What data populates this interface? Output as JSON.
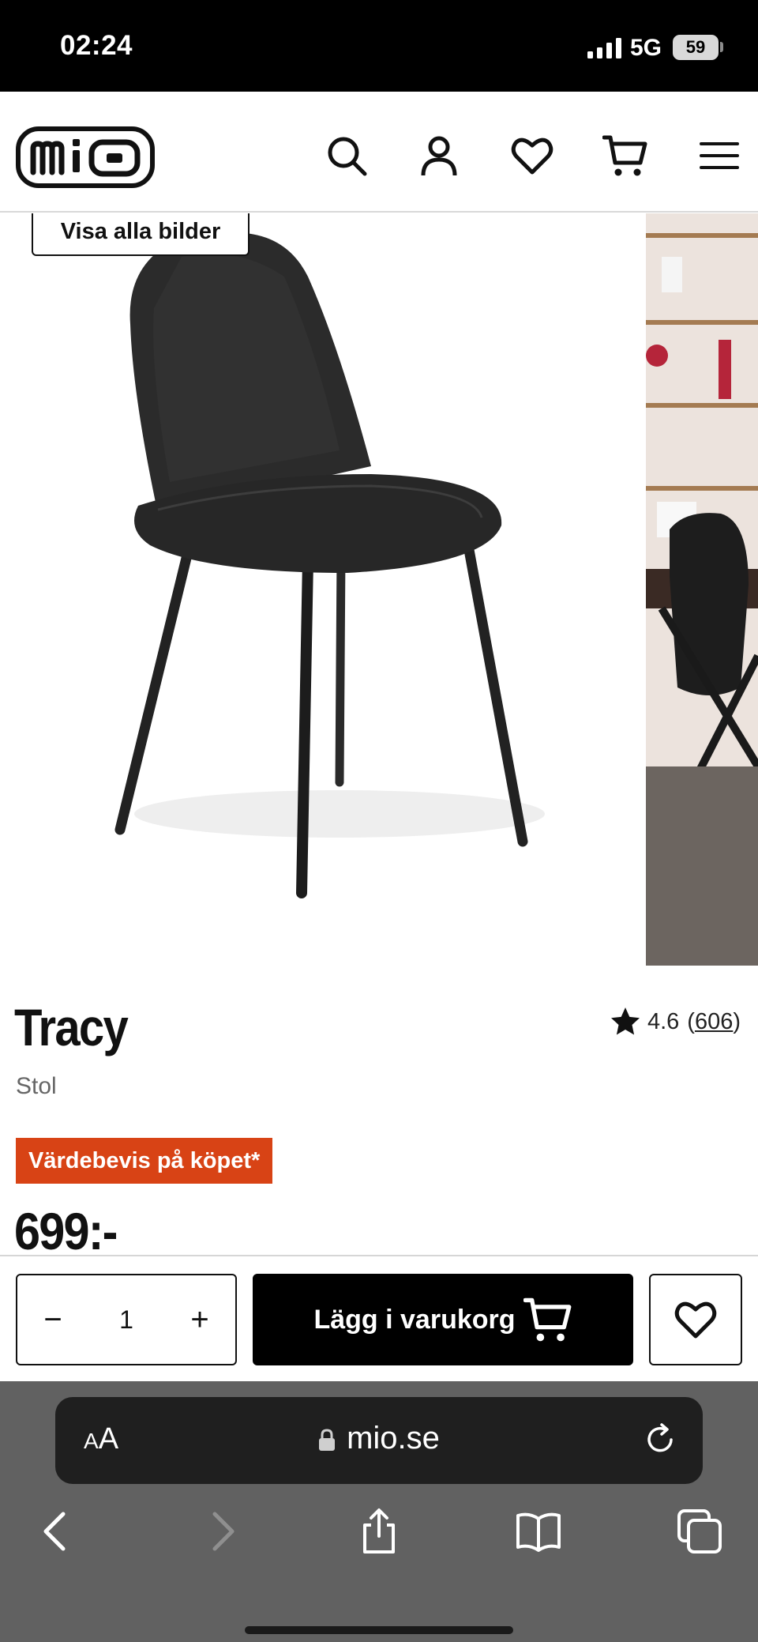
{
  "status_bar": {
    "time": "02:24",
    "network": "5G",
    "battery": "59"
  },
  "header": {
    "logo_text": "mio",
    "icons": [
      "search-icon",
      "account-icon",
      "heart-icon",
      "cart-icon",
      "menu-icon"
    ]
  },
  "gallery": {
    "show_all_label": "Visa alla bilder"
  },
  "product": {
    "name": "Tracy",
    "category": "Stol",
    "rating": "4.6",
    "review_count": "606",
    "badge": "Värdebevis på köpet*",
    "price": "699:-"
  },
  "buy_bar": {
    "quantity": "1",
    "minus_label": "−",
    "plus_label": "+",
    "add_to_cart_label": "Lägg i varukorg"
  },
  "browser": {
    "text_size_label": "A",
    "url": "mio.se",
    "toolbar_icons": [
      "back-icon",
      "forward-icon",
      "share-icon",
      "bookmarks-icon",
      "tabs-icon"
    ]
  },
  "colors": {
    "badge": "#d84315",
    "primary_button": "#000000",
    "browser_chrome": "#616161"
  }
}
